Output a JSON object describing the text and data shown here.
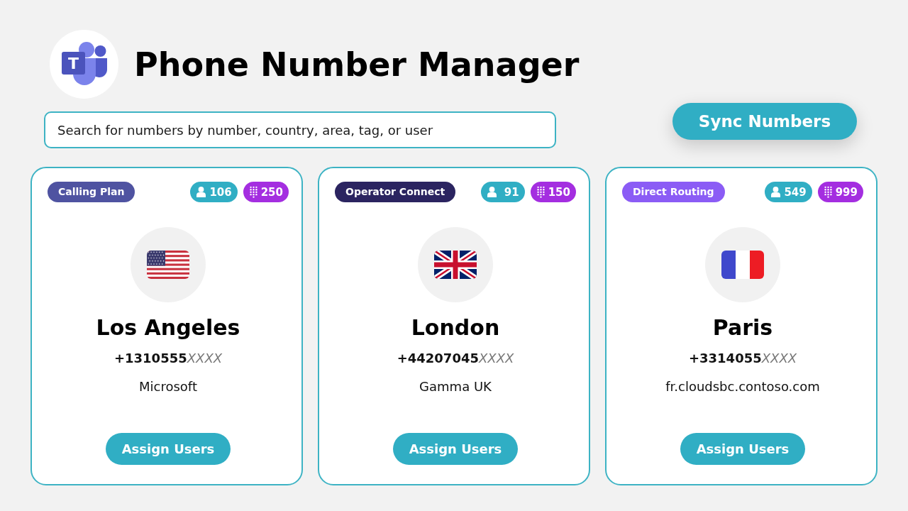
{
  "header": {
    "logo_letter": "T",
    "title": "Phone Number Manager"
  },
  "search": {
    "placeholder": "Search for numbers by number, country, area, tag, or user"
  },
  "sync_button": "Sync Numbers",
  "cards": [
    {
      "kind": "usa",
      "tag": {
        "label": "Calling Plan",
        "color": "#4f53a1"
      },
      "users": "106",
      "numbers": "250",
      "city": "Los Angeles",
      "number": "+1310555",
      "number_masked": "XXXX",
      "carrier": "Microsoft",
      "button": "Assign Users"
    },
    {
      "kind": "uk",
      "tag": {
        "label": "Operator Connect",
        "color": "#2b2460"
      },
      "users": "91",
      "numbers": "150",
      "city": "London",
      "number": "+44207045",
      "number_masked": "XXXX",
      "carrier": "Gamma UK",
      "button": "Assign Users"
    },
    {
      "kind": "france",
      "tag": {
        "label": "Direct Routing",
        "color": "#8b5cf5"
      },
      "users": "549",
      "numbers": "999",
      "city": "Paris",
      "number": "+3314055",
      "number_masked": "XXXX",
      "carrier": "fr.cloudsbc.contoso.com",
      "button": "Assign Users"
    }
  ]
}
